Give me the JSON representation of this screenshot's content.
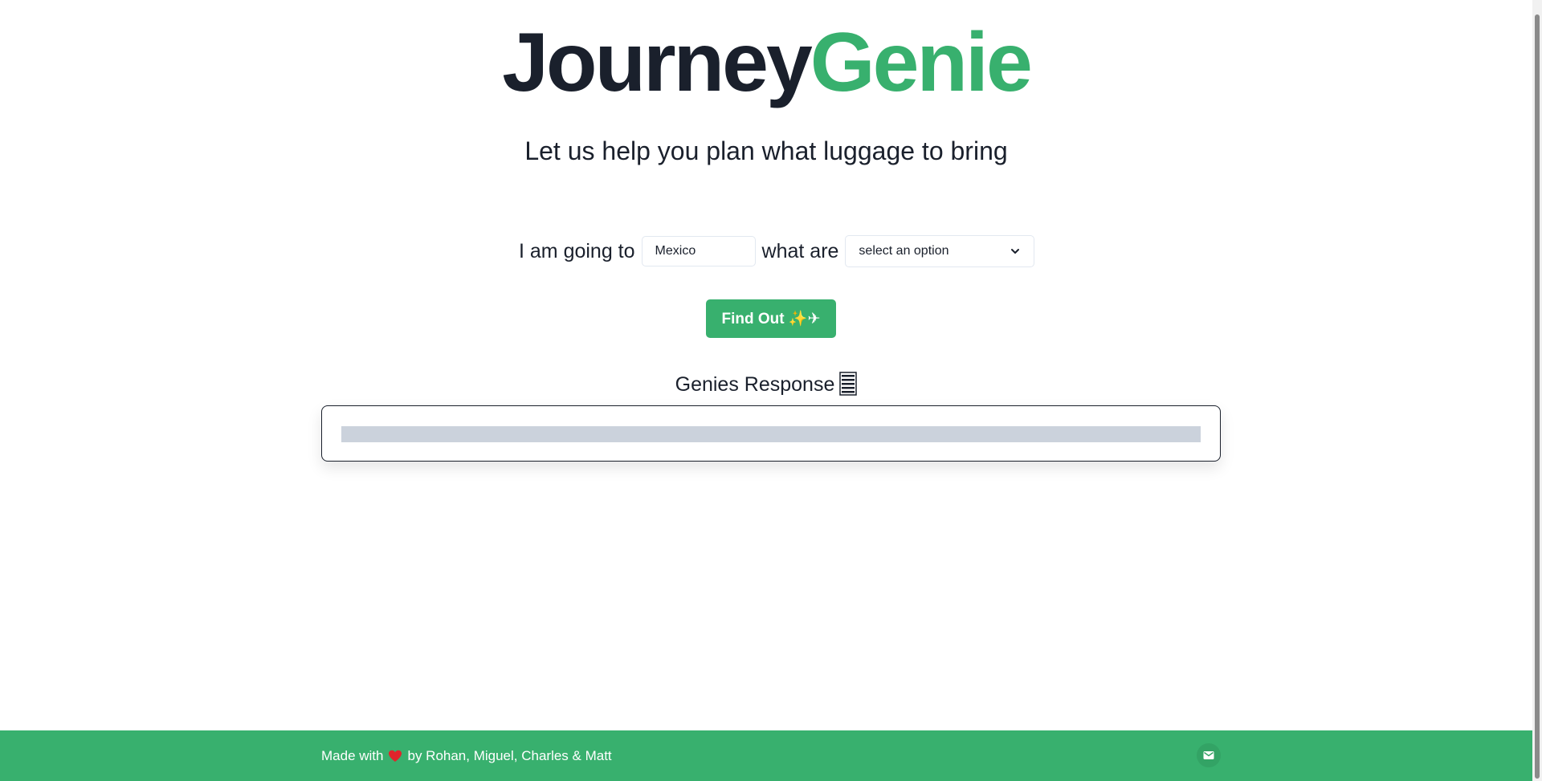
{
  "brand": {
    "title_part1": "Journey",
    "title_part2": "Genie",
    "accent_color": "#38b06e",
    "text_color": "#1a202c"
  },
  "tagline": "Let us help you plan what luggage to bring",
  "form": {
    "prefix_label": "I am going to",
    "destination_value": "Mexico",
    "middle_label": "what are",
    "select_value": "select an option",
    "select_icon": "chevron-down-icon"
  },
  "action": {
    "button_label": "Find Out ✨✈"
  },
  "response": {
    "title": "Genies Response",
    "title_icon": "scroll-icon",
    "loading": true
  },
  "footer": {
    "credit_prefix": "Made with",
    "credit_suffix": "by Rohan, Miguel, Charles & Matt",
    "heart_icon": "heart-icon",
    "contact_icon": "mail-icon"
  }
}
